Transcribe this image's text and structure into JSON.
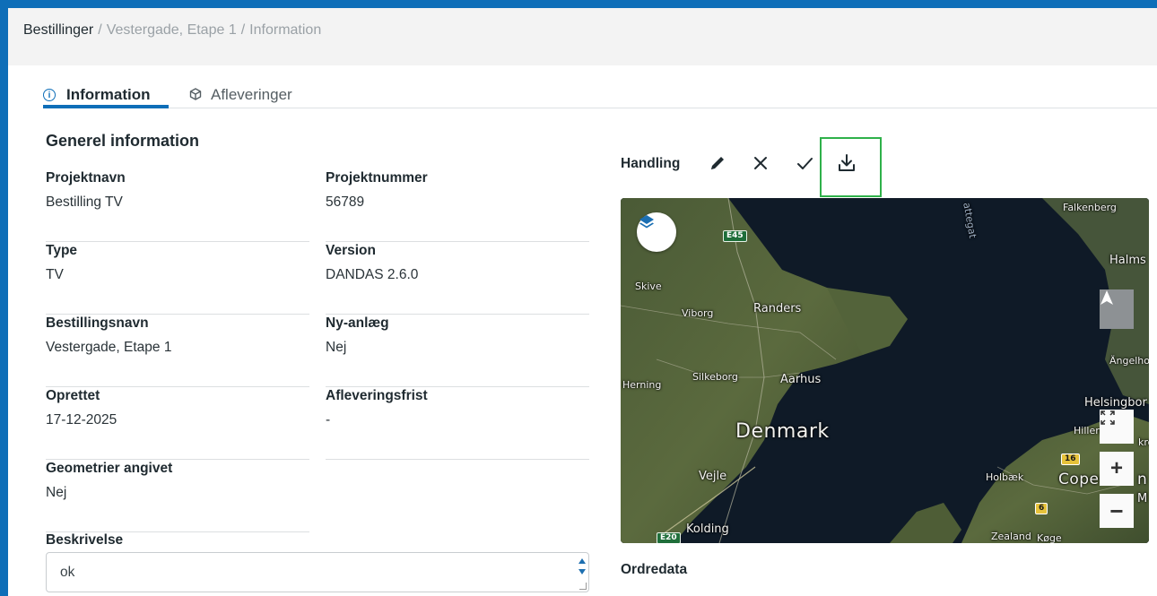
{
  "breadcrumb": {
    "root": "Bestillinger",
    "level2": "Vestergade, Etape 1",
    "level3": "Information",
    "separator": "/"
  },
  "tabs": [
    {
      "label": "Information",
      "icon": "info-circle-icon",
      "active": true
    },
    {
      "label": "Afleveringer",
      "icon": "cube-icon",
      "active": false
    }
  ],
  "general": {
    "title": "Generel information",
    "fields": {
      "projektnavn": {
        "label": "Projektnavn",
        "value": "Bestilling TV"
      },
      "projektnummer": {
        "label": "Projektnummer",
        "value": "56789"
      },
      "type": {
        "label": "Type",
        "value": "TV"
      },
      "version": {
        "label": "Version",
        "value": "DANDAS 2.6.0"
      },
      "bestillingsnavn": {
        "label": "Bestillingsnavn",
        "value": "Vestergade, Etape 1"
      },
      "nyanlaeg": {
        "label": "Ny-anlæg",
        "value": "Nej"
      },
      "oprettet": {
        "label": "Oprettet",
        "value": "17-12-2025"
      },
      "afleveringsfrist": {
        "label": "Afleveringsfrist",
        "value": "-"
      },
      "geometrier": {
        "label": "Geometrier angivet",
        "value": "Nej"
      }
    },
    "beskrivelse": {
      "label": "Beskrivelse",
      "value": "ok"
    }
  },
  "handling": {
    "label": "Handling",
    "tools": [
      "pencil-icon",
      "close-icon",
      "check-icon",
      "download-icon"
    ],
    "highlight_color": "#2fb14a"
  },
  "map": {
    "labels": {
      "kattegat": "attegat",
      "falkenberg": "Falkenberg",
      "halmstad": "Halms",
      "skive": "Skive",
      "viborg": "Viborg",
      "randers": "Randers",
      "angelholm": "Ängelho",
      "herning": "Herning",
      "silkeborg": "Silkeborg",
      "aarhus": "Aarhus",
      "helsingborg": "Helsingbor",
      "denmark": "Denmark",
      "hillerod": "Hillerød",
      "vejle": "Vejle",
      "holbaek": "Holbæk",
      "copenhagen": "Copen",
      "copenhagen_tail": "n",
      "kolding": "Kolding",
      "zealand": "Zealand",
      "koge": "Køge",
      "malmo": "M",
      "krok": "kro"
    },
    "shields": {
      "e45": "E45",
      "e20": "E20",
      "r16": "16",
      "r6": "6"
    },
    "controls": [
      "layers-icon",
      "compass-icon",
      "fullscreen-icon",
      "zoom-in-icon",
      "zoom-out-icon"
    ]
  },
  "ordredata": {
    "label": "Ordredata"
  },
  "colors": {
    "accent": "#0e6eb8",
    "text": "#1f2a30",
    "muted": "#9aa1a6"
  }
}
